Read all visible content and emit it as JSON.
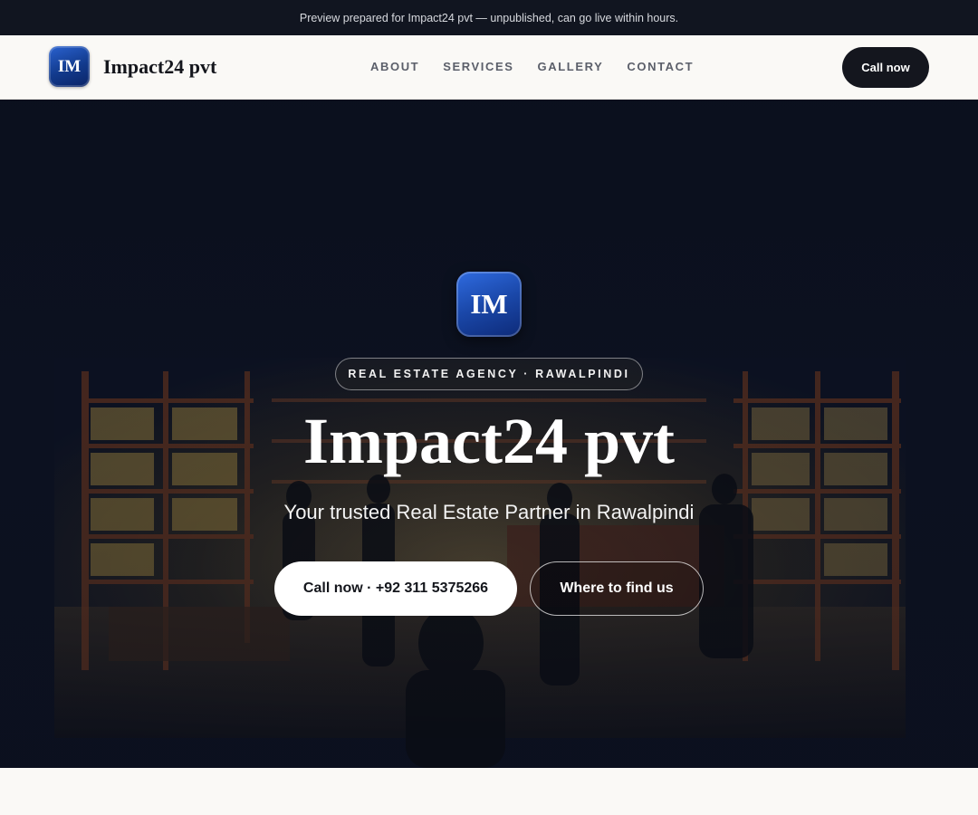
{
  "preview_banner": "Preview prepared for Impact24 pvt — unpublished, can go live within hours.",
  "header": {
    "logo_initials": "IM",
    "brand_name": "Impact24 pvt",
    "nav": [
      "ABOUT",
      "SERVICES",
      "GALLERY",
      "CONTACT"
    ],
    "call_label": "Call now"
  },
  "hero": {
    "logo_initials": "IM",
    "tagline": "REAL ESTATE AGENCY · RAWALPINDI",
    "title": "Impact24 pvt",
    "subtitle": "Your trusted Real Estate Partner in Rawalpindi",
    "primary_button": "Call now · +92 311 5375266",
    "secondary_button": "Where to find us",
    "background_image": "dim photo of a shop interior with shelves and people"
  },
  "colors": {
    "brand_blue": "#1a47a8",
    "dark": "#14161e",
    "page_bg": "#faf9f6"
  }
}
